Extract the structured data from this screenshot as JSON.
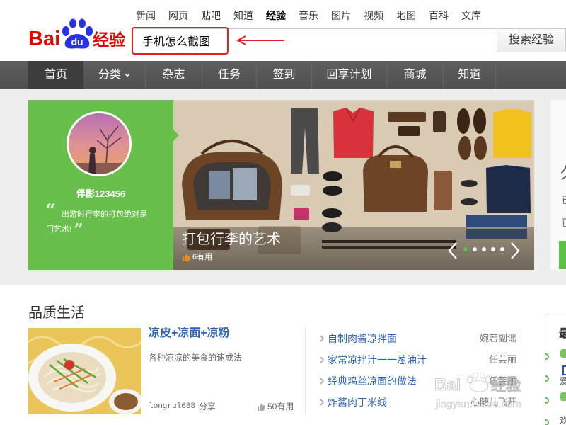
{
  "top_nav": {
    "items": [
      "新闻",
      "网页",
      "贴吧",
      "知道",
      "经验",
      "音乐",
      "图片",
      "视频",
      "地图",
      "百科",
      "文库"
    ],
    "active": "经验"
  },
  "logo": {
    "part1": "Bai",
    "part2": "du",
    "part3": "经验"
  },
  "search": {
    "value": "手机怎么截图",
    "button": "搜索经验"
  },
  "main_nav": {
    "items": [
      "首页",
      "分类",
      "杂志",
      "任务",
      "签到",
      "回享计划",
      "商城",
      "知道"
    ],
    "active": "首页"
  },
  "banner": {
    "user": "伴影123456",
    "quote": "出游时行李的打包绝对是门艺术!",
    "title": "打包行李的艺术",
    "likes": "6有用",
    "slide_count": 5,
    "current_slide": 1
  },
  "right_panel": {
    "heading": "久",
    "line1": "已",
    "line2": "已"
  },
  "quality_life": {
    "heading": "品质生活",
    "feature": {
      "title": "凉皮+凉面+凉粉",
      "desc": "各种凉凉的美食的速成法",
      "author": "longrul688",
      "action": "分享",
      "likes": "50有用"
    },
    "list": [
      {
        "title": "自制肉酱凉拌面",
        "author": "婉若副谣"
      },
      {
        "title": "家常凉拌汁一一葱油汁",
        "author": "任芸丽"
      },
      {
        "title": "经典鸡丝凉面的做法",
        "author": "任芸丽"
      },
      {
        "title": "炸酱肉丁米线",
        "author": "心随儿飞开"
      }
    ]
  },
  "side_panel": {
    "heading": "最",
    "text1": "爱",
    "text2": "欢"
  },
  "watermark": {
    "logo_a": "Bai",
    "logo_b": "经验",
    "url": "jingyan.baidu.com"
  },
  "icons": [
    "paw-icon",
    "chevron-down-icon",
    "thumb-up-icon",
    "chevron-left-icon",
    "chevron-right-icon",
    "chevron-right-small-icon",
    "arrow-left-icon"
  ],
  "colors": {
    "brand_red": "#e10602",
    "brand_blue": "#2932e1",
    "link_blue": "#2d64b3",
    "banner_green": "#69bf4c",
    "nav_bg": "#555555",
    "annotation_red": "#e5201d",
    "like_orange": "#f08a1c"
  }
}
